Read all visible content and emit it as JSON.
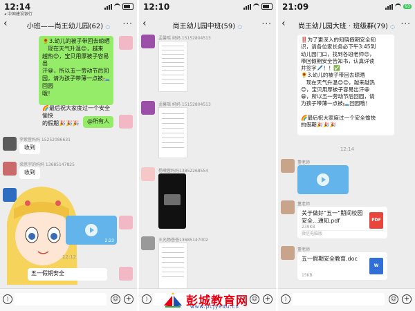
{
  "colors": {
    "accent": "#4a7bd0",
    "bubble_self": "#95ec69",
    "bubble_other": "#ffffff",
    "video": "#63b4ea",
    "pdf": "#e8453c",
    "doc": "#2f6fd6",
    "watermark": "#e60012"
  },
  "panels": [
    {
      "status": {
        "time": "12:14",
        "carrier": "◂ 中国建设银行"
      },
      "title": "小班——尚王幼儿园(62)",
      "notice_lines": [
        "🌻3.幼儿的被子带回去晾晒",
        "　现在天气升温😊，越来",
        "越热😊，宝贝用厚被子容易出",
        "汗😀，所以五一劳动节后回",
        "园，请为孩子带薄一点被🛏️回园",
        "哦！",
        "",
        "🌈最后祝大家度过一个安全愉快",
        "的假期🎉🎉🎉"
      ],
      "mention": "@所有人",
      "senders": [
        "李紫萱妈妈 15252086631",
        "梁思宇的妈妈 13685147825"
      ],
      "replies": [
        "收到",
        "收到",
        "收到"
      ],
      "video_duration": "2:23",
      "timestamp": "12:12",
      "last_message": "五一假期安全"
    },
    {
      "status": {
        "time": "12:10"
      },
      "title": "尚王幼儿园中班(59)",
      "senders": [
        "孟馨瑶 妈妈 15152804513",
        "孟馨瑶 妈妈 15152804513",
        "杨曦蓉妈妈13852268554",
        "王允畅爸爸13685147002"
      ],
      "input_time": "12:10"
    },
    {
      "status": {
        "time": "21:09",
        "battery": "93"
      },
      "title": "尚王幼儿园大班 · 班级群(79)",
      "notice_lines": [
        "‼️为了更深入的知晓假期安全知",
        "识，请各位家长务必下午3:45到",
        "幼儿园门口，找到各班老师😊，",
        "带回假期安全告知书，认真详读",
        "并签字🖊️！！✅",
        "🌻3.幼儿的被子带回去晾晒",
        "　现在天气升温😊😊，越来越热",
        "😊，宝贝用厚被子容易出汗😀",
        "😀，所以五一劳动节后回园，请",
        "为孩子带薄一点被🛏️回园哦！",
        "",
        "🌈最后祝大家度过一个安全愉快",
        "的假期🎉🎉🎉"
      ],
      "timestamp": "12:14",
      "sender": "董老师",
      "file1": {
        "name": "关于做好“五一”期间校园安全...通知.pdf",
        "size": "239KB",
        "source": "微信电脑版",
        "type": "PDF"
      },
      "file2": {
        "name": "五一假期安全教育.doc",
        "size": "15KB",
        "type": "W"
      }
    }
  ],
  "watermark": {
    "title": "彭城教育网",
    "url": "www.pcjyedu.cn"
  }
}
